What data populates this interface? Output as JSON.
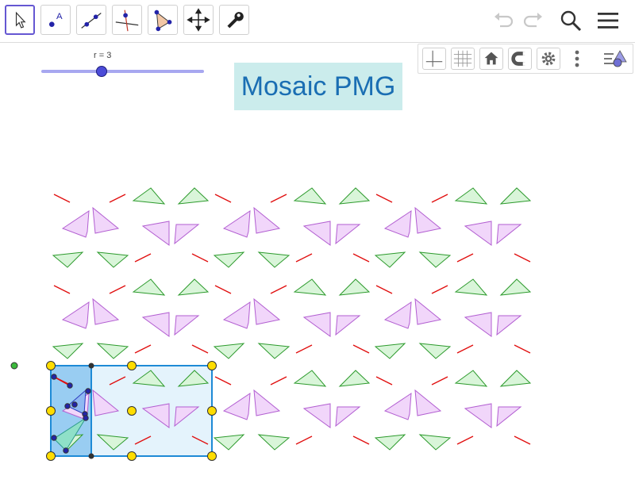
{
  "toolbar": {
    "tools": [
      {
        "name": "move-tool",
        "active": true
      },
      {
        "name": "point-tool",
        "active": false,
        "label": "A"
      },
      {
        "name": "line-tool",
        "active": false
      },
      {
        "name": "perpendicular-line-tool",
        "active": false
      },
      {
        "name": "polygon-tool",
        "active": false
      },
      {
        "name": "move-graphics-view-tool",
        "active": false
      },
      {
        "name": "tools-wrench",
        "active": false
      }
    ],
    "right_icons": [
      "undo-icon",
      "redo-icon",
      "search-icon",
      "menu-icon"
    ]
  },
  "stylebar": {
    "buttons": [
      "axes-toggle",
      "grid-toggle",
      "home-view",
      "point-capturing",
      "graphics-settings",
      "more-options",
      "toggle-style-bar"
    ]
  },
  "slider": {
    "label": "r = 3",
    "value": 3
  },
  "title": "Mosaic PMG",
  "colors": {
    "accent": "#6557d2",
    "slider": "#4b4bd8",
    "title_bg": "#cbecec",
    "title_text": "#1a6eb3",
    "green_fill": "#d9f5d9",
    "green_stroke": "#2c9a2c",
    "purple_fill": "#f1d6fa",
    "purple_stroke": "#b25ed1",
    "red": "#e01010",
    "blue_cell": "#99cdf2",
    "light_blue": "#e4f3fc",
    "yellow_point": "#ffdd00"
  }
}
